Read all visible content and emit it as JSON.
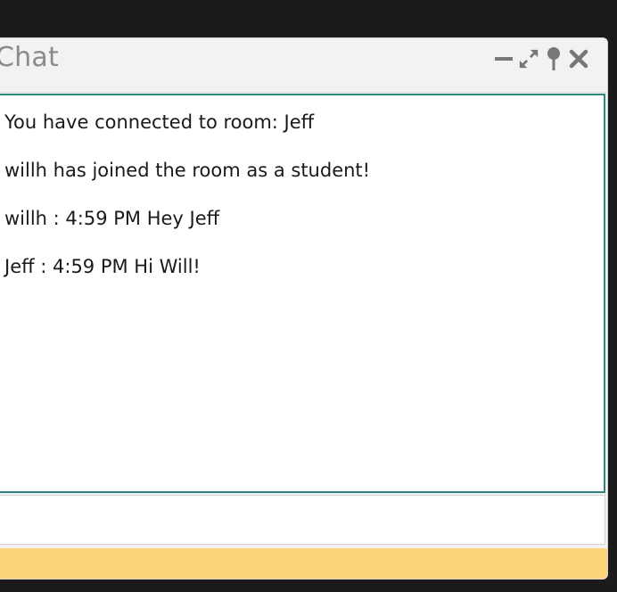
{
  "window": {
    "title": "Chat",
    "controls": [
      {
        "name": "minimize-icon"
      },
      {
        "name": "expand-icon"
      },
      {
        "name": "pin-icon"
      },
      {
        "name": "close-icon"
      }
    ]
  },
  "messages": [
    {
      "text": "You have connected to room: Jeff"
    },
    {
      "text": "willh has joined the room as a student!"
    },
    {
      "text": "willh : 4:59 PM Hey Jeff"
    },
    {
      "text": "Jeff : 4:59 PM Hi Will!"
    }
  ],
  "input": {
    "value": "",
    "placeholder": ""
  },
  "colors": {
    "accent_border": "#2a8a80",
    "footer": "#fdd47a",
    "title_text": "#8a8a8a",
    "control_icons": "#777777"
  }
}
